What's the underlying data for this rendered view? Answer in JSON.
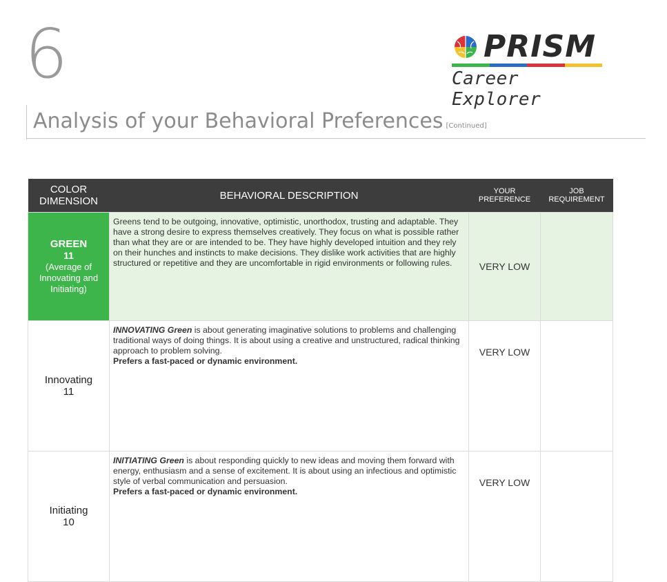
{
  "page": {
    "number": "6",
    "title": "Analysis of your Behavioral Preferences",
    "title_suffix": "[Continued]"
  },
  "logo": {
    "word": "PRISM",
    "subtitle": "Career Explorer",
    "bar_colors": [
      "#3db54a",
      "#2b6cc4",
      "#d8343a",
      "#f2c230"
    ],
    "icon": "brain-icon"
  },
  "table": {
    "headers": {
      "color_dimension": "COLOR DIMENSION",
      "behavioral_description": "BEHAVIORAL DESCRIPTION",
      "your_preference": "YOUR PREFERENCE",
      "job_requirement": "JOB REQUIREMENT"
    },
    "header_color": "#3d3d3d",
    "green_color": "#3db54a",
    "green_tint": "#e6f3e3",
    "rows": [
      {
        "name": "GREEN",
        "score": "11",
        "note": "(Average of Innovating and Initiating)",
        "description": "Greens tend to be outgoing, innovative, optimistic, unorthodox, trusting and adaptable. They have a strong desire to express themselves creatively. They focus on what is possible rather than what they are or are intended to be. They have highly developed intuition and they rely on their hunches and instincts to make decisions. They dislike work activities that are highly structured or repetitive and they are uncomfortable in rigid environments or following rules.",
        "your_preference": "VERY LOW",
        "job_requirement": ""
      },
      {
        "name": "Innovating",
        "score": "11",
        "lead": "INNOVATING Green",
        "description": " is about generating imaginative solutions to problems and challenging traditional ways of doing things. It is about using a creative and unstructured, radical thinking approach to problem solving.",
        "preference_line": "Prefers a fast-paced or dynamic environment.",
        "your_preference": "VERY LOW",
        "job_requirement": ""
      },
      {
        "name": "Initiating",
        "score": "10",
        "lead": "INITIATING Green",
        "description": " is about responding quickly to new ideas and moving them forward with energy, enthusiasm and a sense of excitement. It is about using an infectious and optimistic style of verbal communication and persuasion.",
        "preference_line": "Prefers a fast-paced or dynamic environment.",
        "your_preference": "VERY LOW",
        "job_requirement": ""
      }
    ]
  }
}
